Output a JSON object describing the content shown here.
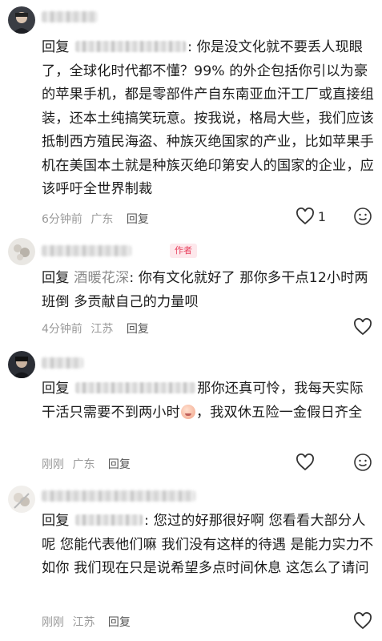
{
  "comments": [
    {
      "reply_prefix": "回复",
      "text": ": 你是没文化就不要丢人现眼了，全球化时代都不懂？99% 的外企包括你引以为豪的苹果手机，都是零部件产自东南亚血汗工厂或直接组装，还本土纯搞笑玩意。按我说，格局大些，我们应该抵制西方殖民海盗、种族灭绝国家的产业，比如苹果手机在美国本土就是种族灭绝印第安人的国家的企业，应该呼吁全世界制裁",
      "time": "6分钟前",
      "location": "广东",
      "reply_label": "回复",
      "like_count": "1",
      "is_author": false
    },
    {
      "reply_prefix": "回复",
      "reply_to": "酒暖花深",
      "text": ": 你有文化就好了 那你多干点12小时两班倒 多贡献自己的力量呗",
      "time": "4分钟前",
      "location": "江苏",
      "reply_label": "回复",
      "author_badge": "作者",
      "is_author": true
    },
    {
      "reply_prefix": "回复",
      "text_a": "那你还真可怜，我每天实际干活只需要不到两小时",
      "text_b": "，我双休五险一金假日齐全",
      "time": "刚刚",
      "location": "广东",
      "reply_label": "回复",
      "is_author": false
    },
    {
      "reply_prefix": "回复",
      "text": ": 您过的好那很好啊 您看看大部分人呢 您能代表他们嘛 我们没有这样的待遇 是能力实力不如你 我们现在只是说希望多点时间休息 这怎么了请问",
      "time": "刚刚",
      "location": "江苏",
      "reply_label": "回复",
      "is_author": false
    }
  ],
  "icons": {
    "like": "heart-outline-icon",
    "emoji": "smiley-face-icon",
    "inline_emoji": "blushing-face-emoji"
  },
  "colors": {
    "author_badge": "#e8415e",
    "meta_text": "#9a9a9a"
  }
}
